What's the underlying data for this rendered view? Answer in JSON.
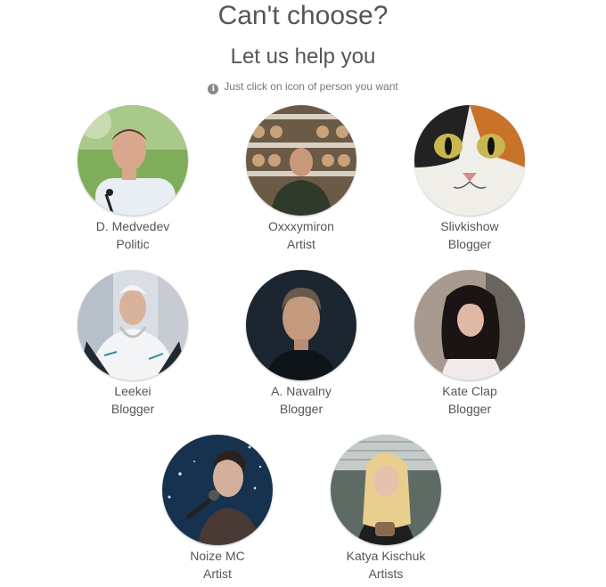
{
  "header": {
    "title": "Can't choose?",
    "subtitle": "Let us help you",
    "hint": "Just click on icon of person you want",
    "hint_icon": "info-icon"
  },
  "people": [
    {
      "name": "D. Medvedev",
      "role": "Politic"
    },
    {
      "name": "Oxxxymiron",
      "role": "Artist"
    },
    {
      "name": "Slivkishow",
      "role": "Blogger"
    },
    {
      "name": "Leekei",
      "role": "Blogger"
    },
    {
      "name": "A. Navalny",
      "role": "Blogger"
    },
    {
      "name": "Kate Clap",
      "role": "Blogger"
    },
    {
      "name": "Noize MC",
      "role": "Artist"
    },
    {
      "name": "Katya Kischuk",
      "role": "Artists"
    }
  ]
}
